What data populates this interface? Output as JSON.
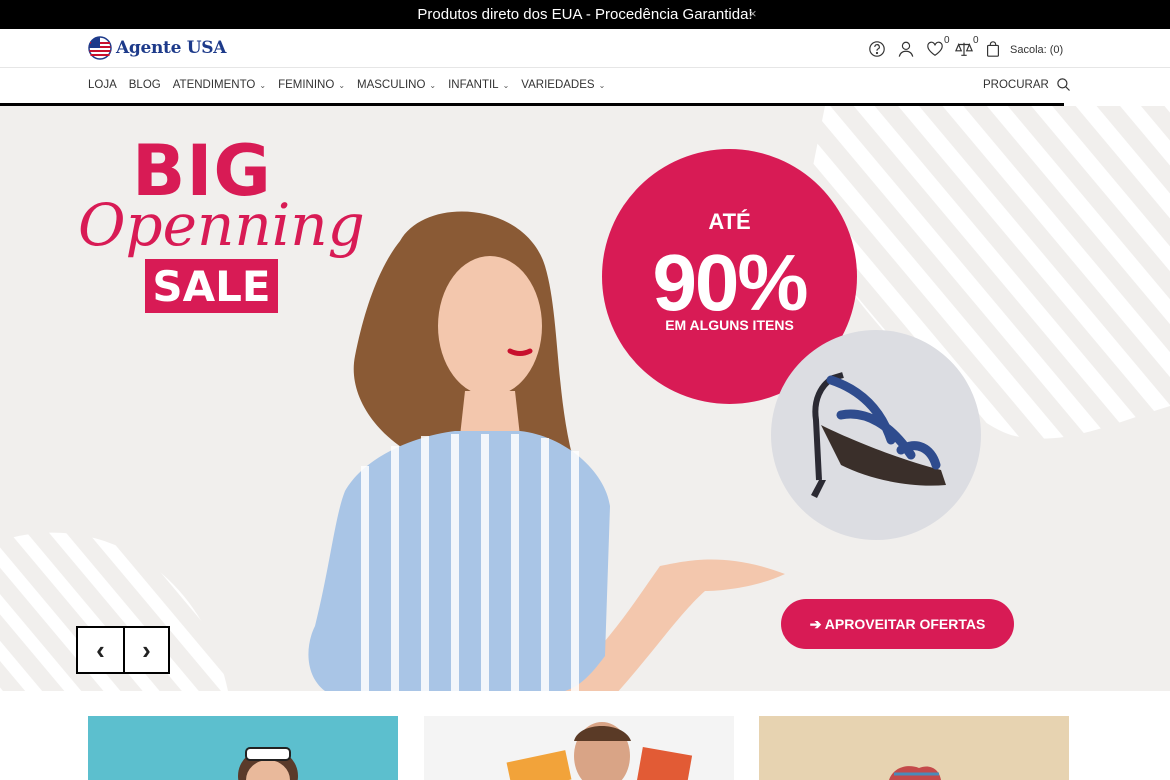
{
  "announcement": {
    "text": "Produtos direto dos EUA - Procedência Garantida!",
    "close": "×"
  },
  "logo": {
    "text": "Agente USA"
  },
  "header": {
    "wishlist_count": "0",
    "compare_count": "0",
    "bag_label": "Sacola: (0)"
  },
  "nav": {
    "items": [
      {
        "label": "LOJA",
        "dropdown": false
      },
      {
        "label": "BLOG",
        "dropdown": false
      },
      {
        "label": "ATENDIMENTO",
        "dropdown": true
      },
      {
        "label": "FEMININO",
        "dropdown": true
      },
      {
        "label": "MASCULINO",
        "dropdown": true
      },
      {
        "label": "INFANTIL",
        "dropdown": true
      },
      {
        "label": "VARIEDADES",
        "dropdown": true
      }
    ],
    "search_label": "PROCURAR"
  },
  "hero": {
    "big": "BIG",
    "openning": "Openning",
    "sale": "SALE",
    "ate": "ATÉ",
    "percent": "90%",
    "some_items": "EM ALGUNS ITENS",
    "cta": "➔ APROVEITAR OFERTAS",
    "prev": "‹",
    "next": "›"
  },
  "colors": {
    "accent": "#d81b55",
    "topbar": "#000000",
    "hero_bg": "#f1efed"
  }
}
